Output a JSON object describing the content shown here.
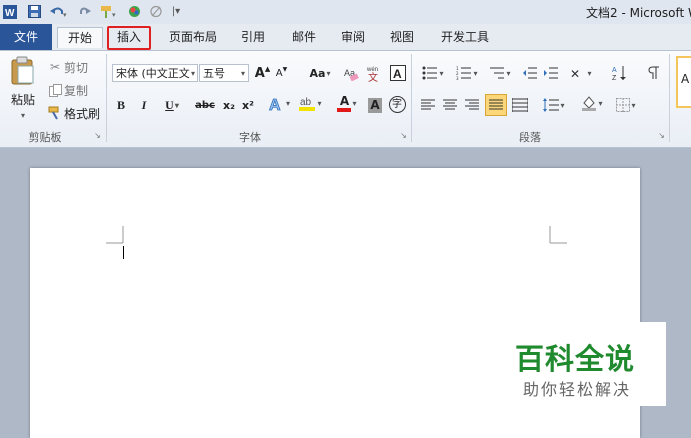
{
  "title_bar": {
    "document_title": "文档2 - Microsoft W",
    "quick_access": [
      "word-logo-icon",
      "save-icon",
      "undo-icon",
      "redo-icon",
      "format-painter-icon",
      "color-icon",
      "eraser-icon",
      "customize-icon"
    ]
  },
  "tabs": {
    "file": "文件",
    "items": [
      "开始",
      "插入",
      "页面布局",
      "引用",
      "邮件",
      "审阅",
      "视图",
      "开发工具"
    ],
    "active": "开始",
    "highlighted": "插入"
  },
  "ribbon": {
    "clipboard": {
      "paste": "粘贴",
      "cut": "剪切",
      "copy": "复制",
      "format_painter": "格式刷",
      "label": "剪贴板"
    },
    "font": {
      "font_name": "宋体 (中文正文",
      "font_size": "五号",
      "grow": "A",
      "shrink": "A",
      "change_case": "Aa",
      "pinyin": "wén",
      "bold": "B",
      "italic": "I",
      "underline": "U",
      "strike": "abc",
      "subscript": "x₂",
      "superscript": "x²",
      "font_color": "A",
      "char_shade": "A",
      "enclose": "字",
      "label": "字体"
    },
    "paragraph": {
      "label": "段落"
    },
    "styles_preview": "A"
  },
  "watermark": {
    "title": "百科全说",
    "subtitle": "助你轻松解决"
  },
  "colors": {
    "file_tab": "#2a5699",
    "highlight_box": "#e02020",
    "watermark_green": "#1f8a2e"
  }
}
